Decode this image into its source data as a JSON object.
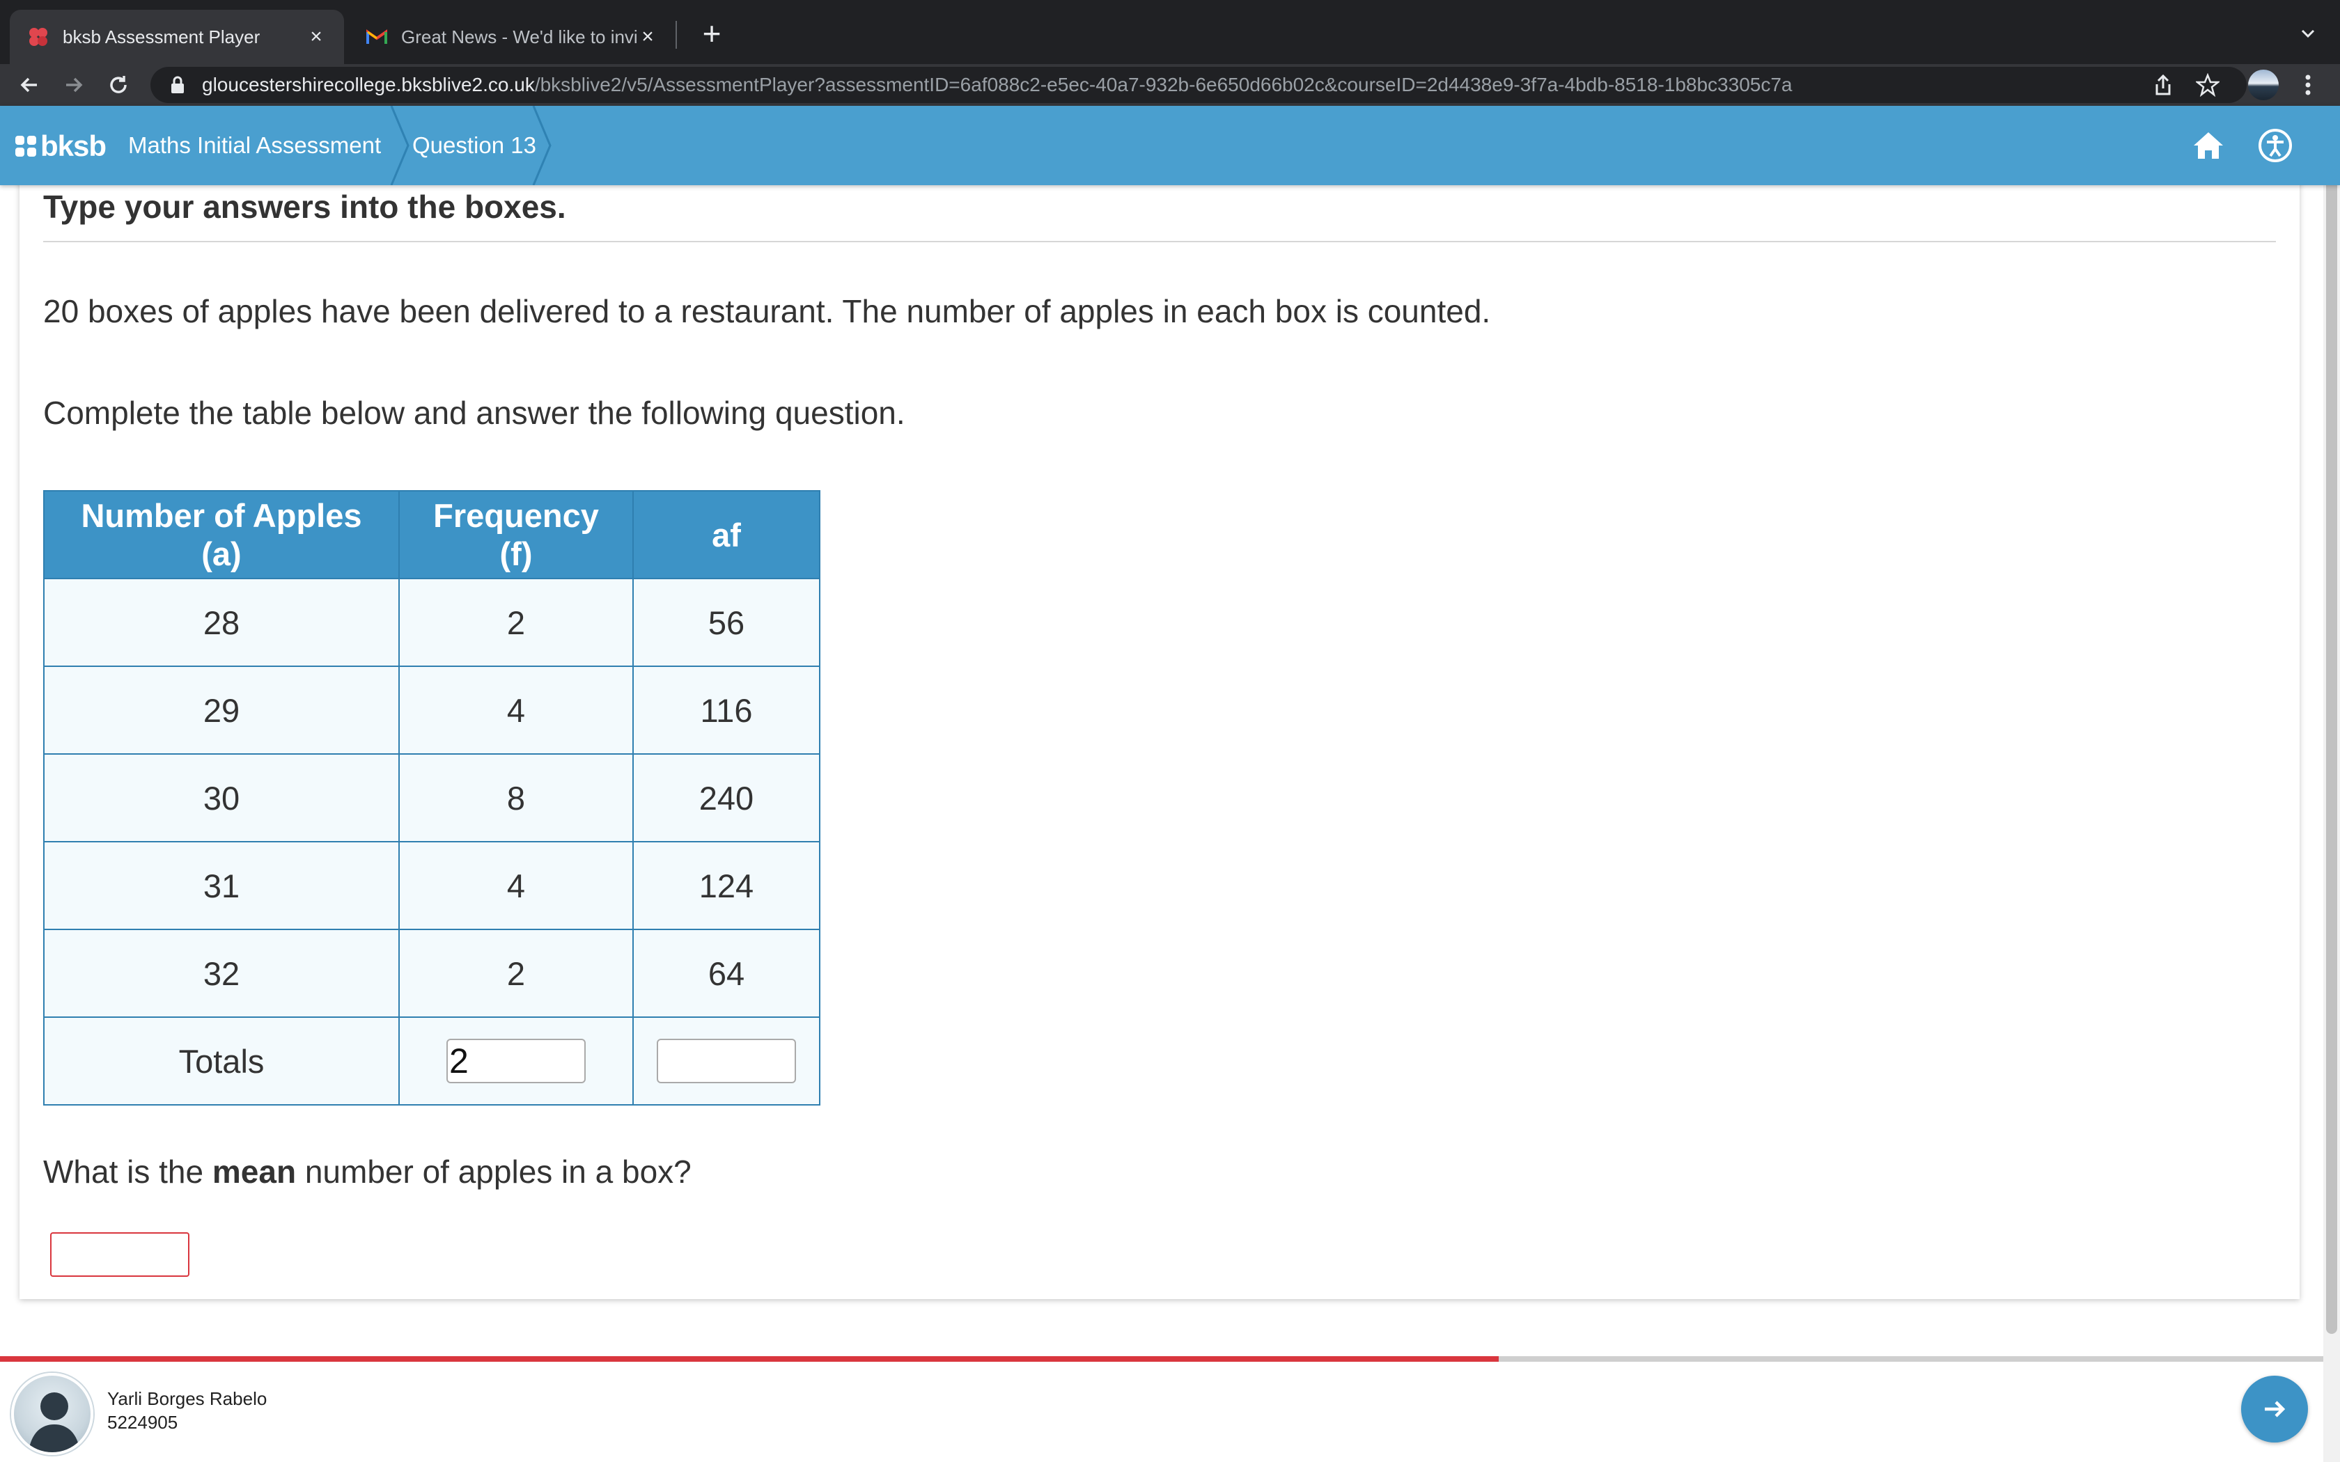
{
  "browser": {
    "tabs": [
      {
        "title": "bksb Assessment Player",
        "active": true,
        "favicon": "bksb-favicon-icon"
      },
      {
        "title": "Great News - We'd like to invite",
        "active": false,
        "favicon": "gmail-icon"
      }
    ],
    "url_host": "gloucestershirecollege.bksblive2.co.uk",
    "url_path": "/bksblive2/v5/AssessmentPlayer?assessmentID=6af088c2-e5ec-40a7-932b-6e650d66b02c&courseID=2d4438e9-3f7a-4bdb-8518-1b8bc3305c7a"
  },
  "header": {
    "logo_text": "bksb",
    "breadcrumbs": [
      "Maths Initial Assessment",
      "Question 13"
    ],
    "accent_color": "#4a9fcf"
  },
  "question": {
    "instruction": "Type your answers into the boxes.",
    "paragraph1": "20 boxes of apples have been delivered to a restaurant. The number of apples in each box is counted.",
    "paragraph2": "Complete the table below and answer the following question.",
    "prompt_before": "What is the",
    "prompt_bold": "mean",
    "prompt_after": "number of apples in a box?",
    "mean_answer_value": ""
  },
  "table": {
    "headers": [
      "Number of Apples (a)",
      "Frequency (f)",
      "af"
    ],
    "rows": [
      [
        "28",
        "2",
        "56"
      ],
      [
        "29",
        "4",
        "116"
      ],
      [
        "30",
        "8",
        "240"
      ],
      [
        "31",
        "4",
        "124"
      ],
      [
        "32",
        "2",
        "64"
      ]
    ],
    "totals_label": "Totals",
    "total_frequency_value": "2",
    "total_af_value": ""
  },
  "footer": {
    "user_name": "Yarli Borges Rabelo",
    "user_id": "5224905",
    "progress_fraction": 0.645,
    "progress_color": "#d9363e"
  }
}
